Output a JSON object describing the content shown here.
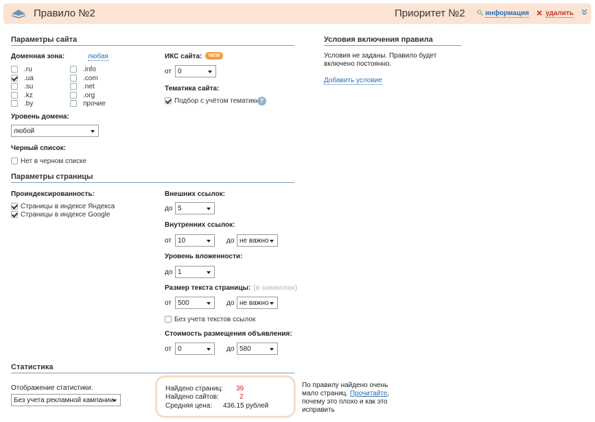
{
  "header": {
    "title": "Правило №2",
    "priority": "Приоритет №2",
    "info_link": "информация",
    "delete_link": "удалить"
  },
  "site_params": {
    "title": "Параметры сайта",
    "domain_zone_label": "Доменная зона:",
    "domain_zone_value": "любая",
    "zones_col1": [
      {
        "label": ".ru",
        "checked": false
      },
      {
        "label": ".ua",
        "checked": true
      },
      {
        "label": ".su",
        "checked": false
      },
      {
        "label": ".kz",
        "checked": false
      },
      {
        "label": ".by",
        "checked": false
      }
    ],
    "zones_col2": [
      {
        "label": ".info",
        "checked": false
      },
      {
        "label": ".com",
        "checked": false
      },
      {
        "label": ".net",
        "checked": false
      },
      {
        "label": ".org",
        "checked": false
      },
      {
        "label": "прочие",
        "checked": false
      }
    ],
    "iks_label": "ИКС сайта:",
    "iks_badge": "NEW",
    "iks_from_label": "от",
    "iks_from_value": "0",
    "topic_label": "Тематика сайта:",
    "topic_checkbox": "Подбор с учётом тематики",
    "topic_help": "?",
    "domain_level_label": "Уровень домена:",
    "domain_level_value": "любой",
    "blacklist_label": "Черный список:",
    "blacklist_checkbox": "Нет в черном списке"
  },
  "conditions": {
    "title": "Условия включения правила",
    "text_line1": "Условия не заданы. Правило будет",
    "text_line2": "включено постоянно.",
    "add_link": "Добавить условие"
  },
  "page_params": {
    "title": "Параметры страницы",
    "indexed_label": "Проиндексированность:",
    "indexed_yandex": "Страницы в индексе Яндекса",
    "indexed_google": "Страницы в индексе Google",
    "external_links_label": "Внешних ссылок:",
    "external_to_label": "до",
    "external_to_value": "5",
    "internal_links_label": "Внутренних ссылок:",
    "internal_from_label": "от",
    "internal_from_value": "10",
    "internal_to_label": "до",
    "internal_to_value": "не важно",
    "nesting_label": "Уровень вложенности:",
    "nesting_to_label": "до",
    "nesting_to_value": "1",
    "text_size_label": "Размер текста страницы:",
    "text_size_hint": "(в символах)",
    "text_size_from_label": "от",
    "text_size_from_value": "500",
    "text_size_to_label": "до",
    "text_size_to_value": "не важно",
    "no_link_texts": "Без учета текстов ссылок",
    "price_label": "Стоимость размещения объявления:",
    "price_from_label": "от",
    "price_from_value": "0",
    "price_to_label": "до",
    "price_to_value": "580"
  },
  "stats": {
    "title": "Статистика",
    "display_label": "Отображение статистики:",
    "display_value": "Без учета рекламной кампании",
    "pages_found_label": "Найдено страниц:",
    "pages_found_value": "39",
    "sites_found_label": "Найдено сайтов:",
    "sites_found_value": "2",
    "avg_price_label": "Средняя цена:",
    "avg_price_value": "436.15 рублей",
    "note_line1": "По правилу найдено очень",
    "note_line2a": "мало страниц.",
    "note_link": "Прочитайте",
    "note_line2b": ",",
    "note_line3": "почему это плохо и как это",
    "note_line4": "исправить"
  },
  "colors": {
    "header_bg": "#fbe4d4",
    "link": "#2a6db5",
    "delete": "#c0392b",
    "badge": "#f39a3b",
    "stat_value": "#d32020"
  }
}
